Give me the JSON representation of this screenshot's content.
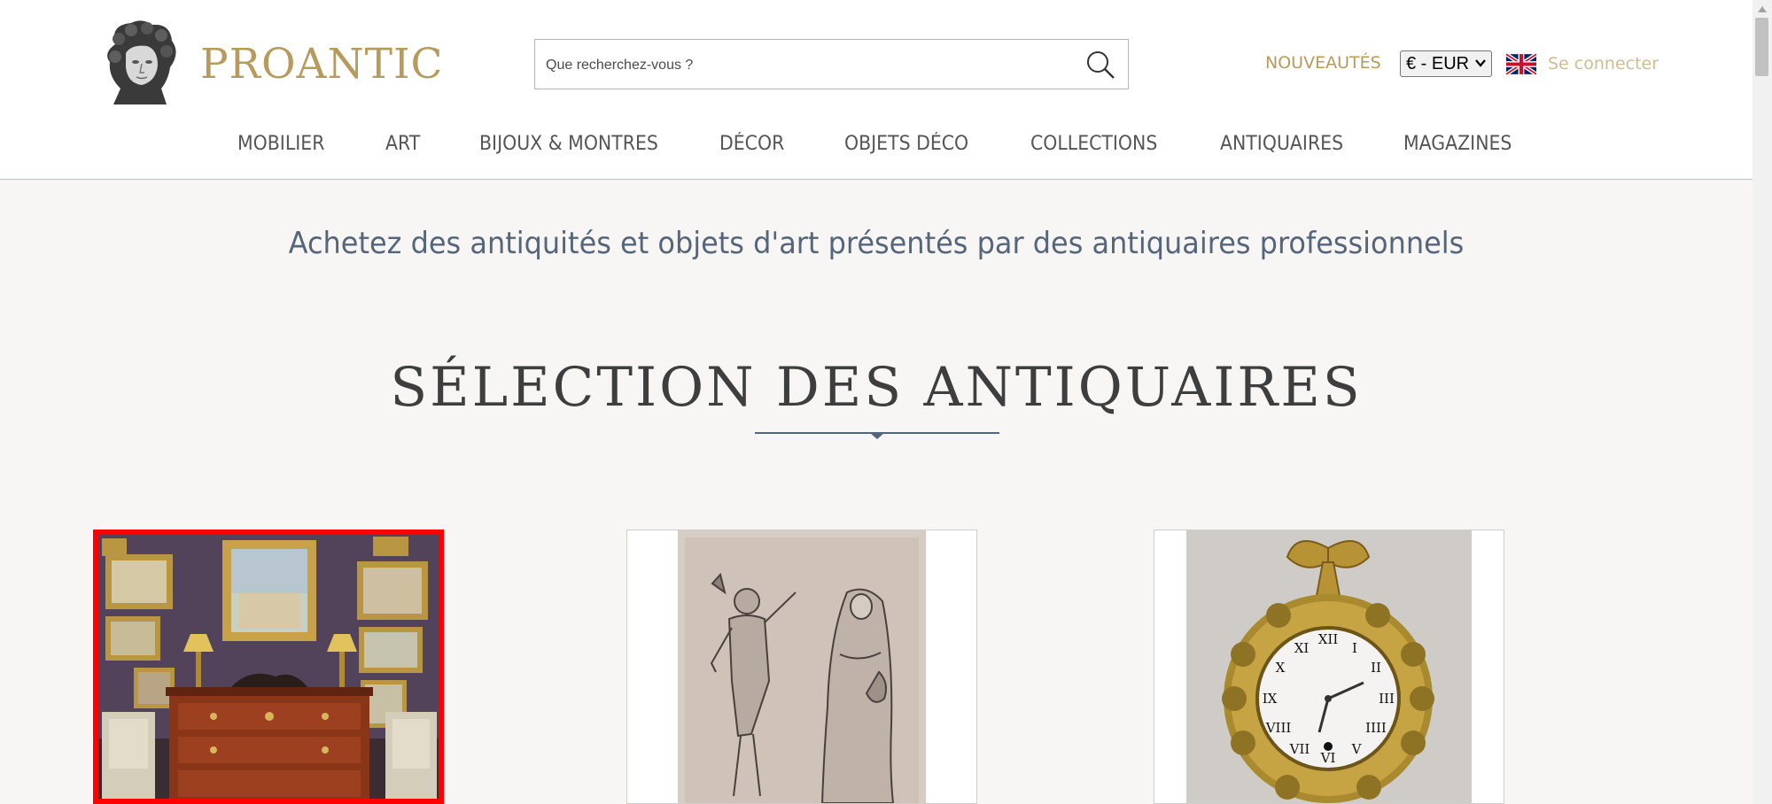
{
  "header": {
    "logo_text": "PROANTIC",
    "search_placeholder": "Que recherchez-vous ?",
    "new_label": "NOUVEAUTÉS",
    "currency": "€ - EUR",
    "language_icon": "uk-flag-icon",
    "login_label": "Se connecter"
  },
  "nav": {
    "items": [
      "MOBILIER",
      "ART",
      "BIJOUX & MONTRES",
      "DÉCOR",
      "OBJETS DÉCO",
      "COLLECTIONS",
      "ANTIQUAIRES",
      "MAGAZINES"
    ]
  },
  "main": {
    "tagline": "Achetez des antiquités et objets d'art présentés par des antiquaires professionnels",
    "section_title": "SÉLECTION DES ANTIQUAIRES",
    "cards": [
      {
        "image": "antique-room-commode-photo",
        "selected": true
      },
      {
        "image": "old-master-drawing-saints-photo",
        "selected": false
      },
      {
        "image": "gilt-bronze-wall-clock-photo",
        "selected": false
      }
    ]
  },
  "colors": {
    "gold": "#b79a5c",
    "login": "#cdbd94",
    "tagline": "#55667a",
    "selection_border": "#ff0000",
    "background": "#f7f6f4"
  }
}
